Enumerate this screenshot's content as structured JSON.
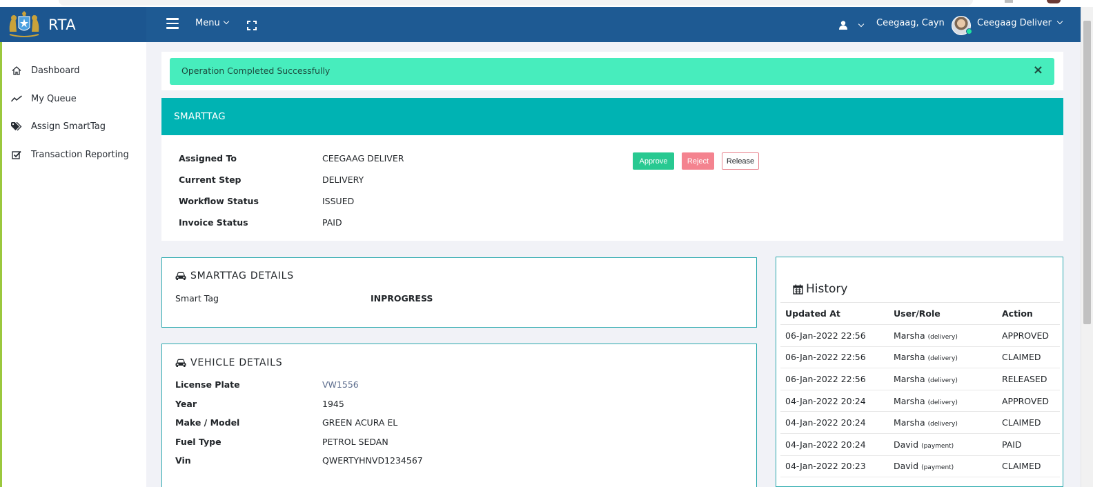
{
  "app": {
    "title": "RTA"
  },
  "navbar": {
    "menu_label": "Menu",
    "user_name": "Ceegaag, Cayn",
    "profile_label": "Ceegaag Deliver"
  },
  "sidebar": {
    "items": [
      {
        "label": "Dashboard",
        "icon": "home-icon"
      },
      {
        "label": "My Queue",
        "icon": "line-chart-icon"
      },
      {
        "label": "Assign SmartTag",
        "icon": "tags-icon"
      },
      {
        "label": "Transaction Reporting",
        "icon": "check-square-icon"
      }
    ]
  },
  "alert": {
    "text": "Operation Completed Successfully",
    "close": "×"
  },
  "smarttag": {
    "title": "SMARTTAG",
    "fields": [
      {
        "label": "Assigned To",
        "value": "CEEGAAG DELIVER"
      },
      {
        "label": "Current Step",
        "value": "DELIVERY"
      },
      {
        "label": "Workflow Status",
        "value": "ISSUED"
      },
      {
        "label": "Invoice Status",
        "value": "PAID"
      }
    ],
    "buttons": {
      "approve": "Approve",
      "reject": "Reject",
      "release": "Release"
    }
  },
  "smarttag_details": {
    "title": "SMARTTAG DETAILS",
    "label": "Smart Tag",
    "value": "INPROGRESS"
  },
  "vehicle_details": {
    "title": "VEHICLE DETAILS",
    "fields": [
      {
        "label": "License Plate",
        "value": "VW1556"
      },
      {
        "label": "Year",
        "value": "1945"
      },
      {
        "label": "Make / Model",
        "value": "GREEN ACURA EL"
      },
      {
        "label": "Fuel Type",
        "value": "PETROL SEDAN"
      },
      {
        "label": "Vin",
        "value": "QWERTYHNVD1234567"
      }
    ]
  },
  "history": {
    "title": "History",
    "columns": [
      "Updated At",
      "User/Role",
      "Action"
    ],
    "rows": [
      {
        "date": "06-Jan-2022 22:56",
        "user": "Marsha",
        "role": "(delivery)",
        "action": "APPROVED"
      },
      {
        "date": "06-Jan-2022 22:56",
        "user": "Marsha",
        "role": "(delivery)",
        "action": "CLAIMED"
      },
      {
        "date": "06-Jan-2022 22:56",
        "user": "Marsha",
        "role": "(delivery)",
        "action": "RELEASED"
      },
      {
        "date": "04-Jan-2022 20:24",
        "user": "Marsha",
        "role": "(delivery)",
        "action": "APPROVED"
      },
      {
        "date": "04-Jan-2022 20:24",
        "user": "Marsha",
        "role": "(delivery)",
        "action": "CLAIMED"
      },
      {
        "date": "04-Jan-2022 20:24",
        "user": "David",
        "role": "(payment)",
        "action": "PAID"
      },
      {
        "date": "04-Jan-2022 20:23",
        "user": "David",
        "role": "(payment)",
        "action": "CLAIMED"
      }
    ]
  },
  "colors": {
    "navbar": "#1e5a93",
    "teal_header": "#00b3b3",
    "alert_bg": "#47edbd",
    "approve": "#28c991",
    "reject": "#f4838f",
    "card_border": "#27a8ad",
    "link": "#5a6b8c"
  }
}
